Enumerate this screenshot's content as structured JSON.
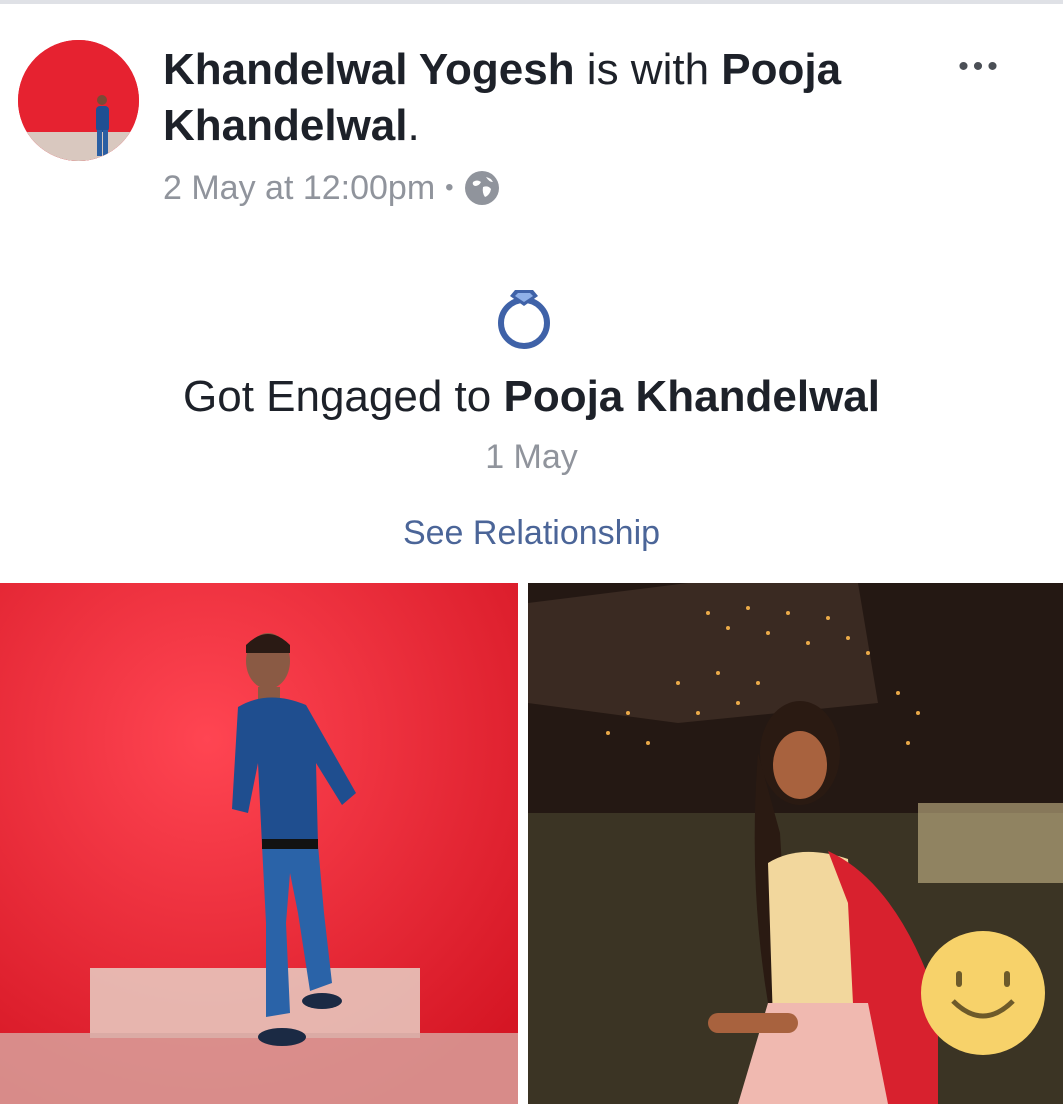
{
  "post": {
    "author": "Khandelwal Yogesh",
    "with_text": " is with ",
    "tagged": "Pooja Khandelwal",
    "period": ".",
    "timestamp": "2 May at 12:00pm",
    "separator": "•",
    "more_label": "•••",
    "privacy_icon": "globe-icon"
  },
  "life_event": {
    "icon": "engagement-ring-icon",
    "prefix": "Got Engaged to ",
    "partner": "Pooja Khandelwal",
    "date": "1 May",
    "link_label": "See Relationship"
  },
  "colors": {
    "link": "#4b6598",
    "text": "#1d2129",
    "muted": "#90949c",
    "ring": "#3f62a8",
    "photo_red": "#e5222e"
  }
}
